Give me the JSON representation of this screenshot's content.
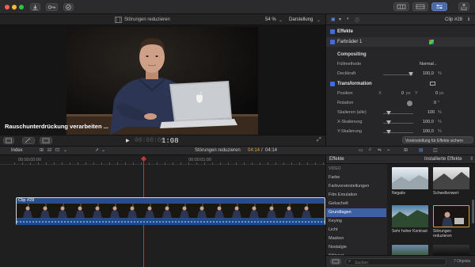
{
  "toolbar": {
    "clip_name": "Störungen reduzieren",
    "zoom": "54 %",
    "view_menu": "Darstellung",
    "clip_number": "Clip #28"
  },
  "viewer": {
    "title_overlay": "Rauschunterdrückung verarbeiten ...",
    "timecode": "1:08",
    "timecode_prefix": "00:00:00"
  },
  "inspector": {
    "effects_header": "Effekte",
    "effect_item": "Farbräder 1",
    "compositing_header": "Compositing",
    "blend_mode_label": "Füllmethode",
    "blend_mode_value": "Normal",
    "opacity_label": "Deckkraft",
    "opacity_value": "100,0",
    "opacity_unit": "%",
    "transform_header": "Transformation",
    "position_label": "Position",
    "position_x_label": "X",
    "position_x_value": "0",
    "position_x_unit": "px",
    "position_y_label": "Y",
    "position_y_value": "0",
    "position_y_unit": "px",
    "rotation_label": "Rotation",
    "rotation_value": "0",
    "rotation_unit": "°",
    "scale_all_label": "Skalieren (alle)",
    "scale_all_value": "100",
    "scale_all_unit": "%",
    "scale_x_label": "X-Skalierung",
    "scale_x_value": "100,0",
    "scale_x_unit": "%",
    "scale_y_label": "Y-Skalierung",
    "scale_y_value": "100,0",
    "scale_y_unit": "%",
    "save_preset_button": "Voreinstellung für Effekte sichern"
  },
  "timeline": {
    "index_label": "Index",
    "project_name": "Störungen reduzieren",
    "duration_current": "04:14",
    "duration_separator": "/",
    "duration_total": "04:14",
    "ruler_tc_1": "00:00:00:00",
    "ruler_tc_2": "00:00:01:00",
    "clip_label": "Clip #28"
  },
  "effects_browser": {
    "tab_label": "Effekte",
    "installed_label": "Installierte Effekte",
    "section_video": "VIDEO",
    "categories": [
      "Farbe",
      "Farbvoreinstellungen",
      "Film Emulation",
      "Gekachelt",
      "Grundlagen",
      "Keying",
      "Licht",
      "Masken",
      "Nostalgie",
      "Stilisiert"
    ],
    "selected_index": 4,
    "thumbnails": [
      {
        "label": "Negativ"
      },
      {
        "label": "Schwellenwert"
      },
      {
        "label": "Sehr hoher Kontrast"
      },
      {
        "label": "Störungen reduzieren"
      }
    ],
    "search_placeholder": "Suchen",
    "count_label": "7 Objekte"
  },
  "colors": {
    "selection_blue": "#3d5fa3",
    "clip_blue": "#2a4c86",
    "playhead_red": "#c0392b",
    "accent_orange": "#e0a030"
  }
}
